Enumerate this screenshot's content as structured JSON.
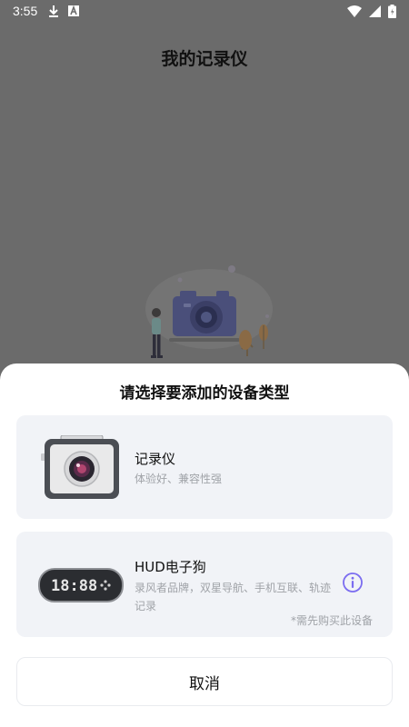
{
  "status_bar": {
    "time": "3:55",
    "left_icons": [
      "download-icon",
      "font-icon"
    ],
    "right_icons": [
      "wifi-icon",
      "signal-icon",
      "battery-icon"
    ]
  },
  "page": {
    "title": "我的记录仪"
  },
  "sheet": {
    "title": "请选择要添加的设备类型",
    "options": [
      {
        "name": "记录仪",
        "description": "体验好、兼容性强",
        "icon": "dashcam-device-icon"
      },
      {
        "name": "HUD电子狗",
        "description": "录风者品牌，双星导航、手机互联、轨迹记录",
        "note": "*需先购买此设备",
        "icon": "hud-device-icon",
        "display_digits": "18:88"
      }
    ],
    "cancel_label": "取消"
  },
  "colors": {
    "overlay": "#6b6b6b",
    "sheet_bg": "#ffffff",
    "card_bg": "#f1f3f7",
    "info_accent": "#7b6cf0",
    "muted_text": "#a0a3a8"
  }
}
